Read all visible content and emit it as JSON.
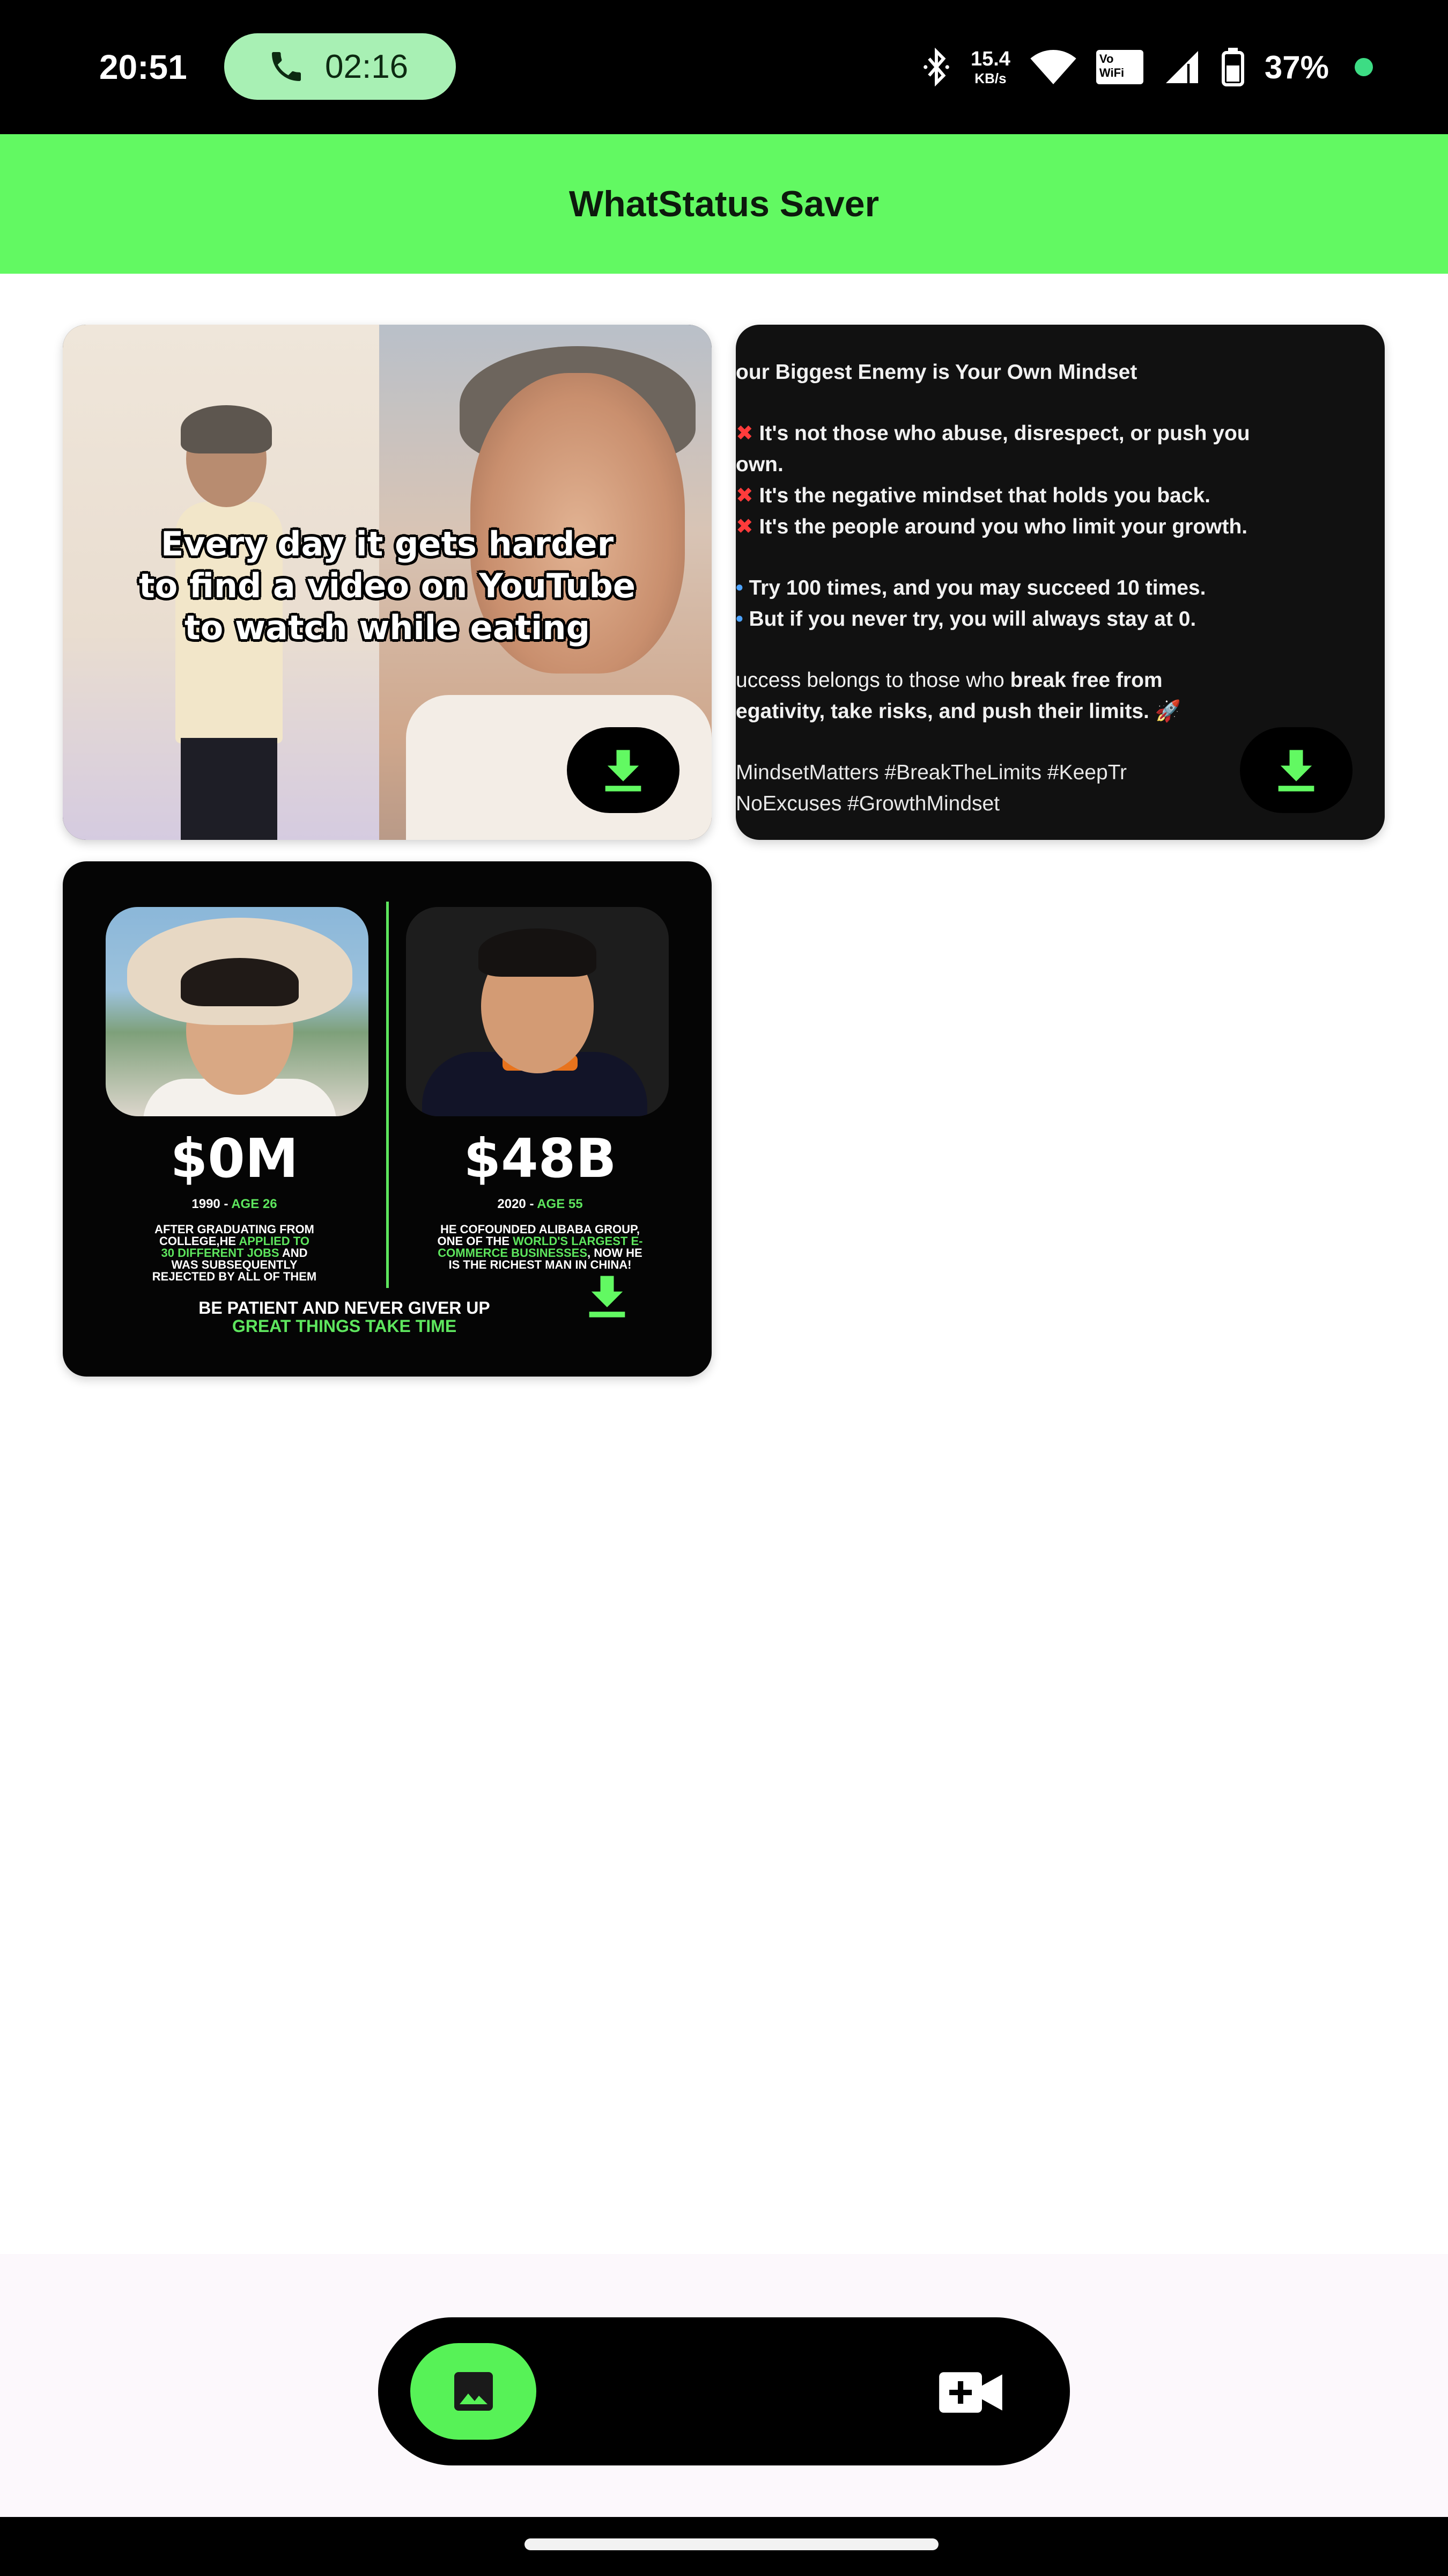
{
  "status_bar": {
    "time": "20:51",
    "call_duration": "02:16",
    "net_speed_value": "15.4",
    "net_speed_unit": "KB/s",
    "vowifi_top": "Vo",
    "vowifi_bottom": "WiFi",
    "battery_percent": "37%"
  },
  "app_bar": {
    "title": "WhatStatus Saver"
  },
  "cards": {
    "meme": {
      "line1": "Every day it gets harder",
      "line2": "to find a video on YouTube",
      "line3": "to watch while eating"
    },
    "text_post": {
      "title": "our Biggest Enemy is Your Own Mindset",
      "x1a": "It's not those who abuse, disrespect, or push you",
      "x1b": "own.",
      "x2": "It's the negative mindset that holds you back.",
      "x3": "It's the people around you who limit your growth.",
      "t1": "Try 100 times, and you may succeed 10 times.",
      "t2": "But if you never try, you will always stay at 0.",
      "s1_pre": "uccess belongs to those who ",
      "s1_bold": "break free from",
      "s2": "egativity, take risks, and push their limits. 🚀",
      "h1": "MindsetMatters #BreakTheLimits #KeepTr",
      "h2": "NoExcuses #GrowthMindset"
    },
    "comparison": {
      "left_amount": "$0M",
      "left_year": "1990 - ",
      "left_age": "AGE 26",
      "left_blurb_1": "AFTER GRADUATING FROM",
      "left_blurb_2a": "COLLEGE,HE ",
      "left_blurb_2b": "APPLIED TO",
      "left_blurb_3a": "30 DIFFERENT JOBS",
      "left_blurb_3b": " AND",
      "left_blurb_4": "WAS SUBSEQUENTLY",
      "left_blurb_5": "REJECTED BY ALL OF THEM",
      "right_amount": "$48B",
      "right_year": "2020 - ",
      "right_age": "AGE 55",
      "right_blurb_1": "HE COFOUNDED ALIBABA GROUP,",
      "right_blurb_2a": "ONE OF THE ",
      "right_blurb_2b": "WORLD'S LARGEST E-",
      "right_blurb_3a": "COMMERCE BUSINESSES",
      "right_blurb_3b": ", NOW HE",
      "right_blurb_4": "IS THE RICHEST MAN IN CHINA!",
      "footer_1": "BE PATIENT AND NEVER GIVER UP",
      "footer_2": "GREAT THINGS TAKE TIME"
    }
  },
  "bottom_nav": {
    "items": [
      {
        "icon": "image-icon",
        "active": true
      },
      {
        "icon": "video-add-icon",
        "active": false
      }
    ]
  },
  "colors": {
    "accent_green": "#62f962",
    "status_bar_bg": "#000000",
    "nav_bg": "#000000"
  }
}
